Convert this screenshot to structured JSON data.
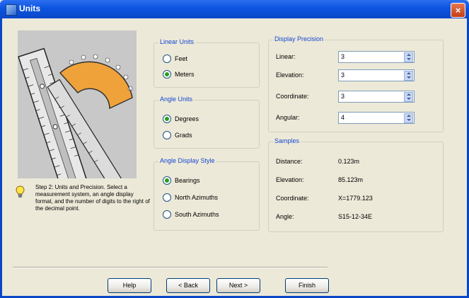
{
  "window": {
    "title": "Units",
    "close_label": "×"
  },
  "step_text": "Step 2:  Units and Precision. Select a measurement system, an angle display format, and the number of digits to the right of the decimal point.",
  "linear_units": {
    "title": "Linear Units",
    "options": [
      "Feet",
      "Meters"
    ],
    "selected": "Meters"
  },
  "angle_units": {
    "title": "Angle Units",
    "options": [
      "Degrees",
      "Grads"
    ],
    "selected": "Degrees"
  },
  "angle_display": {
    "title": "Angle Display Style",
    "options": [
      "Bearings",
      "North Azimuths",
      "South Azimuths"
    ],
    "selected": "Bearings"
  },
  "display_precision": {
    "title": "Display Precision",
    "fields": [
      {
        "label": "Linear:",
        "value": "3"
      },
      {
        "label": "Elevation:",
        "value": "3"
      },
      {
        "label": "Coordinate:",
        "value": "3"
      },
      {
        "label": "Angular:",
        "value": "4"
      }
    ]
  },
  "samples": {
    "title": "Samples",
    "rows": [
      {
        "label": "Distance:",
        "value": "0.123m"
      },
      {
        "label": "Elevation:",
        "value": "85.123m"
      },
      {
        "label": "Coordinate:",
        "value": "X=1779.123"
      },
      {
        "label": "Angle:",
        "value": "S15-12-34E"
      }
    ]
  },
  "buttons": {
    "help": "Help",
    "back": "< Back",
    "next": "Next >",
    "finish": "Finish"
  }
}
